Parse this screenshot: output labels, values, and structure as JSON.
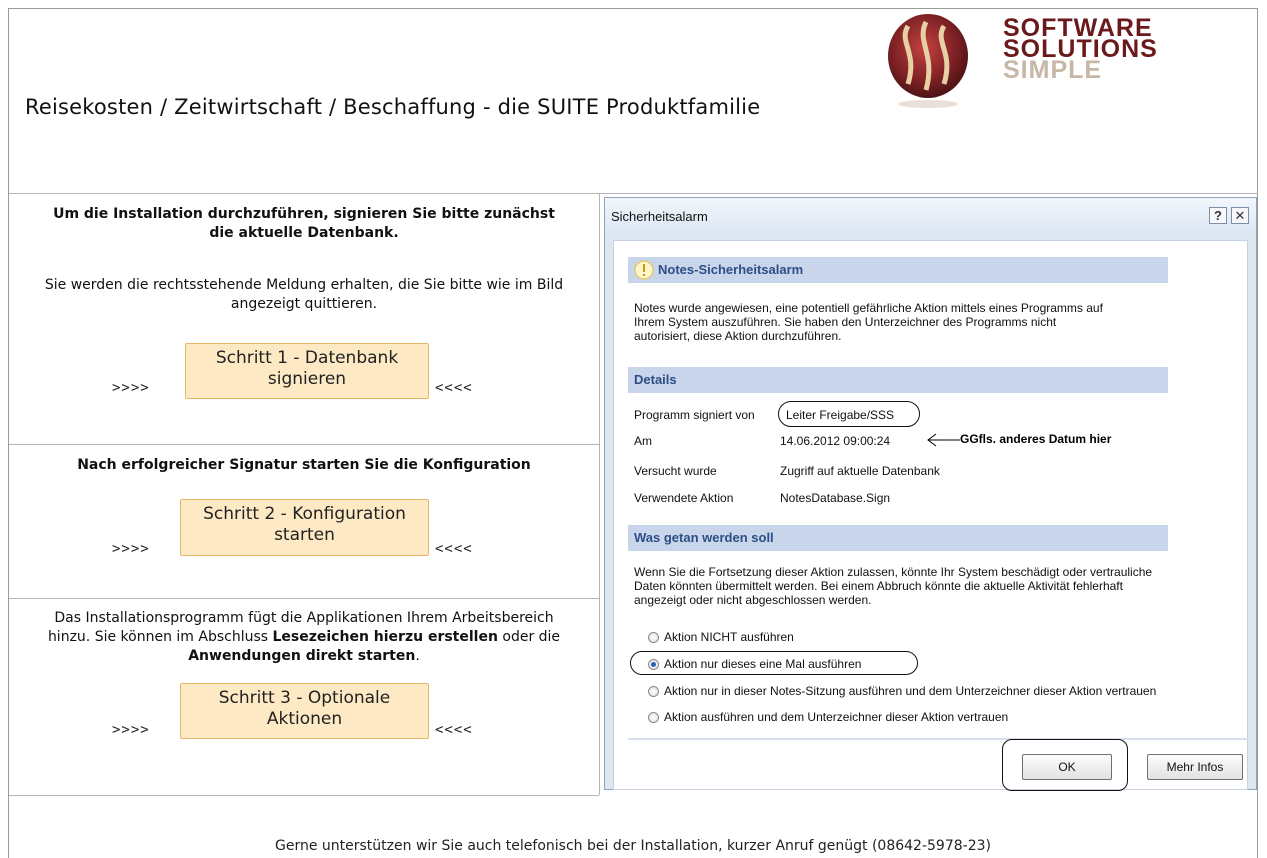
{
  "header": {
    "title": "Reisekosten / Zeitwirtschaft / Beschaffung - die SUITE Produktfamilie",
    "logo_lines": [
      "SOFTWARE",
      "SOLUTIONS",
      "SIMPLE"
    ]
  },
  "steps_panel": {
    "intro_heading": "Um die Installation durchzuführen, signieren Sie bitte zunächst die aktuelle Datenbank.",
    "intro_text": "Sie werden die rechtsstehende Meldung erhalten, die Sie bitte wie im Bild angezeigt quittieren.",
    "arrows_left": ">>>>",
    "arrows_right": "<<<<",
    "step1_label": "Schritt 1 - Datenbank signieren",
    "section2_heading": "Nach erfolgreicher Signatur starten Sie die Konfiguration",
    "step2_label": "Schritt 2 - Konfiguration starten",
    "section3_text_1": "Das Installationsprogramm fügt die Applikationen Ihrem Arbeitsbereich hinzu. Sie können im Abschluss ",
    "section3_bold_1": "Lesezeichen hierzu erstellen",
    "section3_text_2": " oder die ",
    "section3_bold_2": "Anwendungen direkt starten",
    "section3_text_3": ".",
    "step3_label": "Schritt 3 - Optionale Aktionen"
  },
  "dialog": {
    "title": "Sicherheitsalarm",
    "help_glyph": "?",
    "close_glyph": "✕",
    "alarm_heading": "Notes-Sicherheitsalarm",
    "alarm_text": "Notes wurde angewiesen, eine potentiell gefährliche Aktion mittels eines Programms auf Ihrem System auszuführen. Sie haben den Unterzeichner des Programms nicht autorisiert, diese Aktion durchzuführen.",
    "details_heading": "Details",
    "details": [
      {
        "label": "Programm signiert von",
        "value": "Leiter Freigabe/SSS"
      },
      {
        "label": "Am",
        "value": "14.06.2012 09:00:24"
      },
      {
        "label": "Versucht wurde",
        "value": "Zugriff auf aktuelle Datenbank"
      },
      {
        "label": "Verwendete Aktion",
        "value": "NotesDatabase.Sign"
      }
    ],
    "date_annotation": "GGfls. anderes Datum hier",
    "todo_heading": "Was getan werden soll",
    "todo_text": "Wenn Sie die Fortsetzung dieser Aktion zulassen, könnte Ihr System beschädigt oder vertrauliche Daten könnten übermittelt werden. Bei einem Abbruch könnte die aktuelle Aktivität fehlerhaft angezeigt oder nicht abgeschlossen werden.",
    "options": [
      {
        "label": "Aktion NICHT ausführen",
        "selected": false
      },
      {
        "label": "Aktion nur dieses eine Mal ausführen",
        "selected": true
      },
      {
        "label": "Aktion nur in dieser Notes-Sitzung ausführen und dem Unterzeichner dieser Aktion vertrauen",
        "selected": false
      },
      {
        "label": "Aktion ausführen und dem Unterzeichner dieser Aktion vertrauen",
        "selected": false
      }
    ],
    "ok_label": "OK",
    "more_info_label": "Mehr Infos"
  },
  "footer": {
    "text": "Gerne unterstützen wir Sie auch telefonisch bei der Installation, kurzer Anruf genügt (08642-5978-23)"
  },
  "colors": {
    "step_button_bg": "#fdeac4",
    "step_button_border": "#e2b768",
    "logo_dark": "#6b1a1c",
    "logo_light": "#c7b7a6",
    "dialog_band": "#c9d5ea",
    "dialog_band_text": "#2c4f86"
  }
}
